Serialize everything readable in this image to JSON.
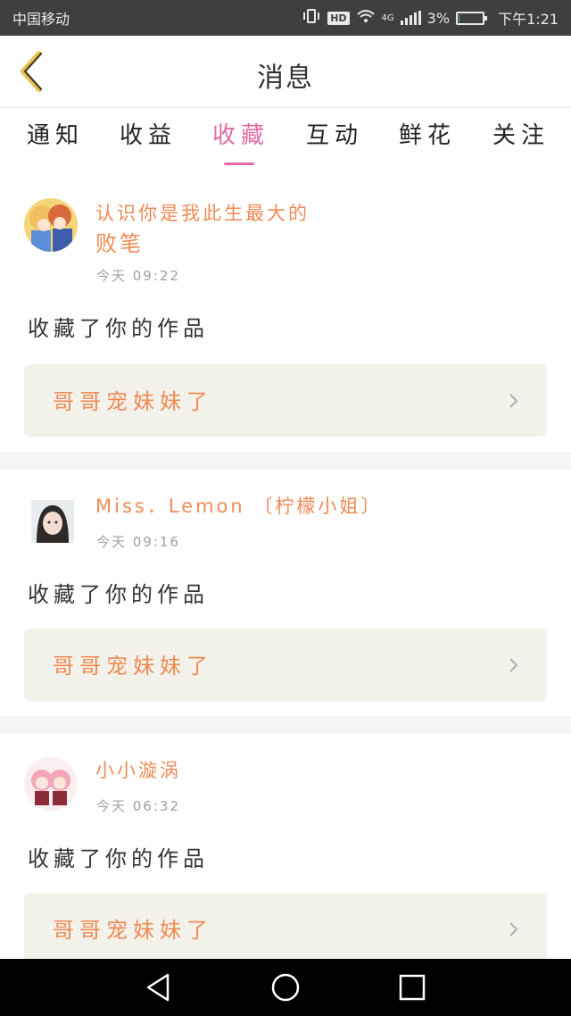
{
  "status_bar": {
    "carrier": "中国移动",
    "hd": "HD",
    "network": "4G",
    "battery_percent": "3%",
    "battery_level": 0.03,
    "time": "下午1:21"
  },
  "header": {
    "title": "消息"
  },
  "tabs": [
    {
      "label": "通知"
    },
    {
      "label": "收益"
    },
    {
      "label": "收藏"
    },
    {
      "label": "互动"
    },
    {
      "label": "鲜花"
    },
    {
      "label": "关注"
    }
  ],
  "active_tab": "收藏",
  "notifications": [
    {
      "user_line1": "认识你是我此生最大的",
      "user_line2": "败笔",
      "time": "今天 09:22",
      "action": "收藏了你的作品",
      "work_title": "哥哥宠妹妹了"
    },
    {
      "user_line1": "Miss．Lemon 〔柠檬小姐〕",
      "time": "今天 09:16",
      "action": "收藏了你的作品",
      "work_title": "哥哥宠妹妹了"
    },
    {
      "user_line1": "小小漩涡",
      "time": "今天 06:32",
      "action": "收藏了你的作品",
      "work_title": "哥哥宠妹妹了"
    }
  ],
  "colors": {
    "accent_pink": "#e46aa2",
    "name_orange": "#f08a55",
    "back_arrow": "#e6c04a"
  }
}
